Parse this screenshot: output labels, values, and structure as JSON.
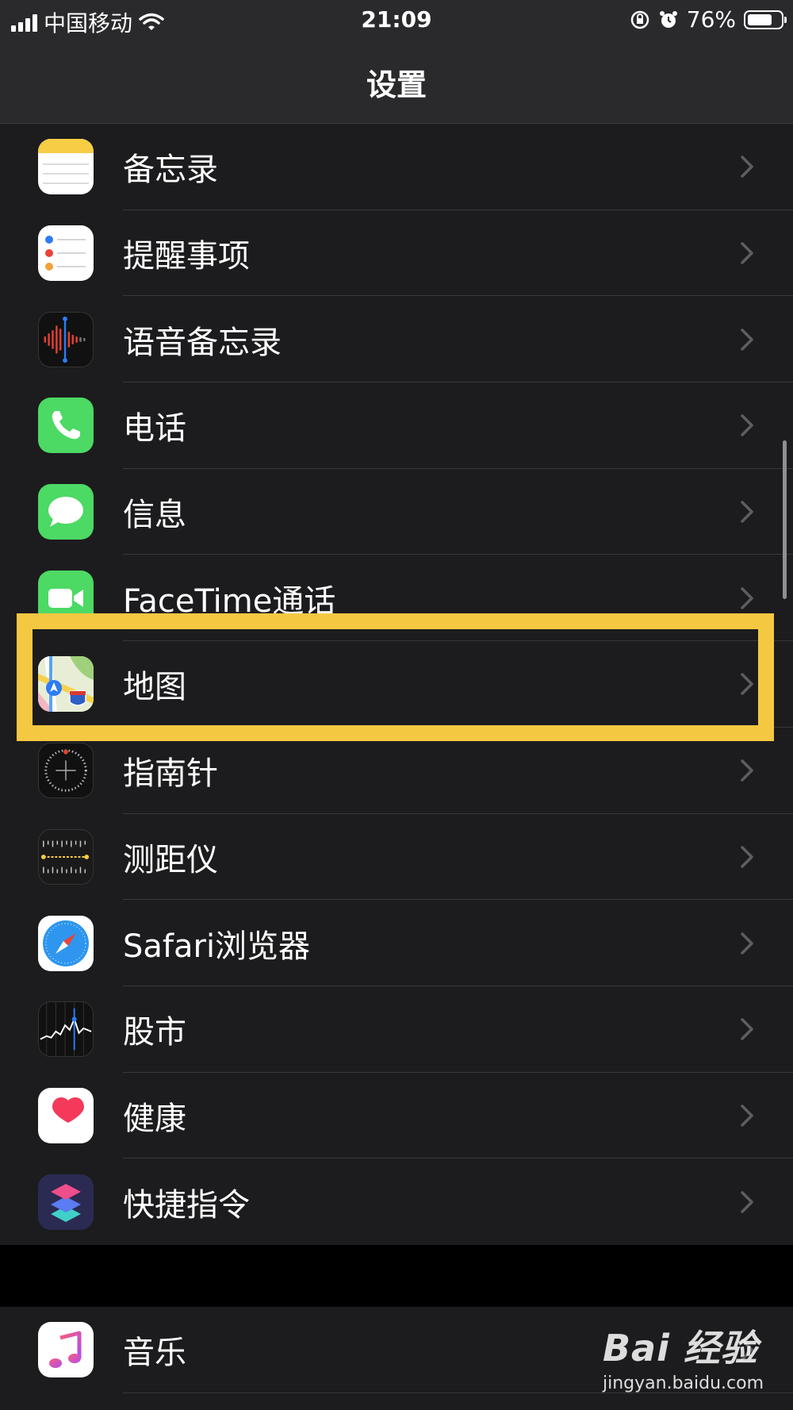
{
  "status_bar": {
    "carrier": "中国移动",
    "time": "21:09",
    "battery": "76%",
    "battery_level": 0.76,
    "icons": [
      "signal-icon",
      "wifi-icon",
      "orientation-lock-icon",
      "alarm-icon",
      "battery-icon"
    ]
  },
  "nav": {
    "title": "设置"
  },
  "group1": {
    "items": [
      {
        "label": "备忘录",
        "icon": "notes-icon"
      },
      {
        "label": "提醒事项",
        "icon": "reminders-icon"
      },
      {
        "label": "语音备忘录",
        "icon": "voice-memos-icon"
      },
      {
        "label": "电话",
        "icon": "phone-icon"
      },
      {
        "label": "信息",
        "icon": "messages-icon"
      },
      {
        "label": "FaceTime通话",
        "icon": "facetime-icon"
      },
      {
        "label": "地图",
        "icon": "maps-icon",
        "highlighted": true
      },
      {
        "label": "指南针",
        "icon": "compass-icon"
      },
      {
        "label": "测距仪",
        "icon": "measure-icon"
      },
      {
        "label": "Safari浏览器",
        "icon": "safari-icon"
      },
      {
        "label": "股市",
        "icon": "stocks-icon"
      },
      {
        "label": "健康",
        "icon": "health-icon"
      },
      {
        "label": "快捷指令",
        "icon": "shortcuts-icon"
      }
    ]
  },
  "group2": {
    "items": [
      {
        "label": "音乐",
        "icon": "music-icon"
      }
    ]
  },
  "highlight_color": "#f5c842",
  "watermark": {
    "logo": "Bai  经验",
    "url": "jingyan.baidu.com"
  }
}
